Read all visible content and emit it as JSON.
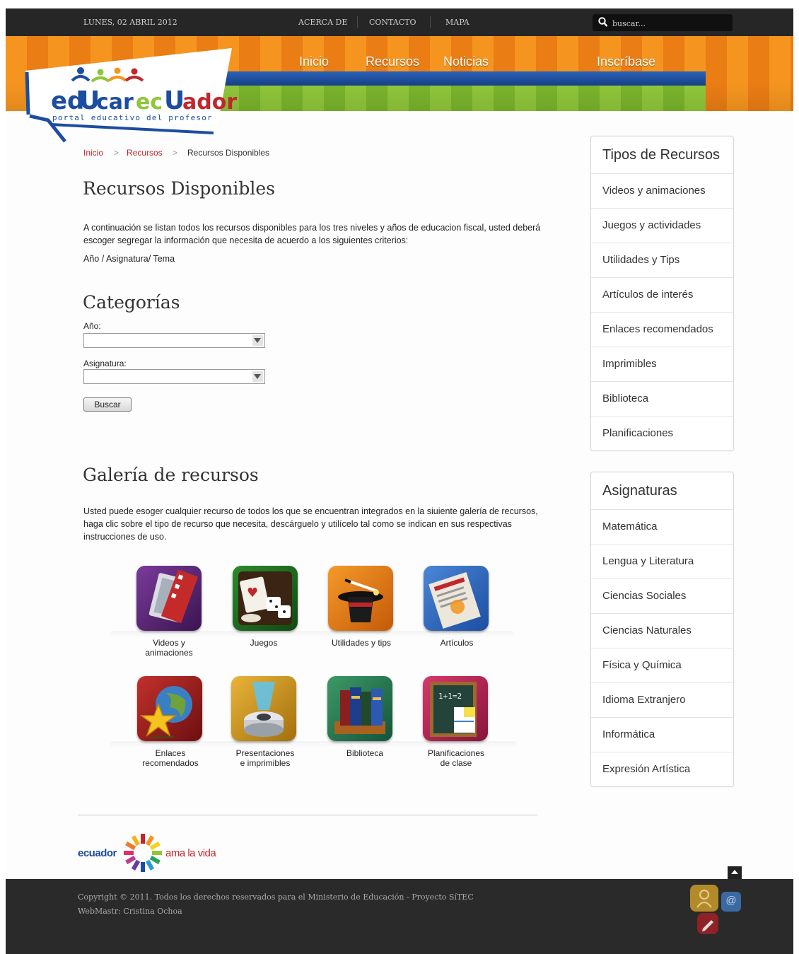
{
  "topbar": {
    "date": "LUNES, 02 ABRIL 2012",
    "links": [
      "ACERCA DE",
      "CONTACTO",
      "MAPA"
    ],
    "search_placeholder": "buscar..."
  },
  "logo": {
    "name": "edUcarecUador",
    "tagline": "portal educativo del profesor"
  },
  "nav": [
    "Inicio",
    "Recursos",
    "Noticias",
    "Inscríbase"
  ],
  "breadcrumb": [
    "Inicio",
    "Recursos",
    "Recursos Disponibles"
  ],
  "page_title": "Recursos Disponibles",
  "intro": "A continuación se listan todos los recursos disponibles para los tres niveles y años de educacion fiscal, usted deberá escoger segregar la información que necesita de acuerdo a los siguientes criterios:",
  "criteria": "Año / Asignatura/ Tema",
  "categories": {
    "title": "Categorías",
    "year_label": "Año:",
    "subject_label": "Asignatura:",
    "year_value": "",
    "subject_value": "",
    "button": "Buscar"
  },
  "gallery": {
    "title": "Galería de recursos",
    "description": "Usted puede esoger cualquier recurso de todos los que se encuentran integrados en la siuiente galería de recursos, haga clic sobre el tipo de recurso que necesita, descárguelo y utilícelo tal como se indican en sus respectivas instrucciones de uso.",
    "items": [
      {
        "line1": "Videos y",
        "line2": "animaciones",
        "icon": "film-icon"
      },
      {
        "line1": "Juegos",
        "line2": "",
        "icon": "dice-cards-icon"
      },
      {
        "line1": "Utilidades y tips",
        "line2": "",
        "icon": "magic-hat-icon"
      },
      {
        "line1": "Artículos",
        "line2": "",
        "icon": "newspaper-icon"
      },
      {
        "line1": "Enlaces",
        "line2": "recomendados",
        "icon": "globe-star-icon"
      },
      {
        "line1": "Presentaciones",
        "line2": "e imprimibles",
        "icon": "projector-icon"
      },
      {
        "line1": "Biblioteca",
        "line2": "",
        "icon": "books-icon"
      },
      {
        "line1": "Planificaciones",
        "line2": "de clase",
        "icon": "chalkboard-icon"
      }
    ]
  },
  "sidebar": {
    "types_title": "Tipos de Recursos",
    "types": [
      "Videos y animaciones",
      "Juegos y actividades",
      "Utilidades y Tips",
      "Artículos de interés",
      "Enlaces recomendados",
      "Imprimibles",
      "Biblioteca",
      "Planificaciones"
    ],
    "subjects_title": "Asignaturas",
    "subjects": [
      "Matemática",
      "Lengua y Literatura",
      "Ciencias Sociales",
      "Ciencias Naturales",
      "Física y Química",
      "Idioma Extranjero",
      "Informática",
      "Expresión Artística"
    ]
  },
  "footer": {
    "brand_left": "ecuador",
    "brand_right": "ama la vida",
    "copyright": "Copyright © 2011. Todos los derechos reservados para el Ministerio de Educación - Proyecto SíTEC",
    "webmaster": "WebMastr: Cristina Ochoa"
  },
  "colors": {
    "accent_red": "#c0262c",
    "orange": "#f5951f",
    "blue": "#2a63b8",
    "green": "#8fc63a",
    "dark": "#262626"
  }
}
